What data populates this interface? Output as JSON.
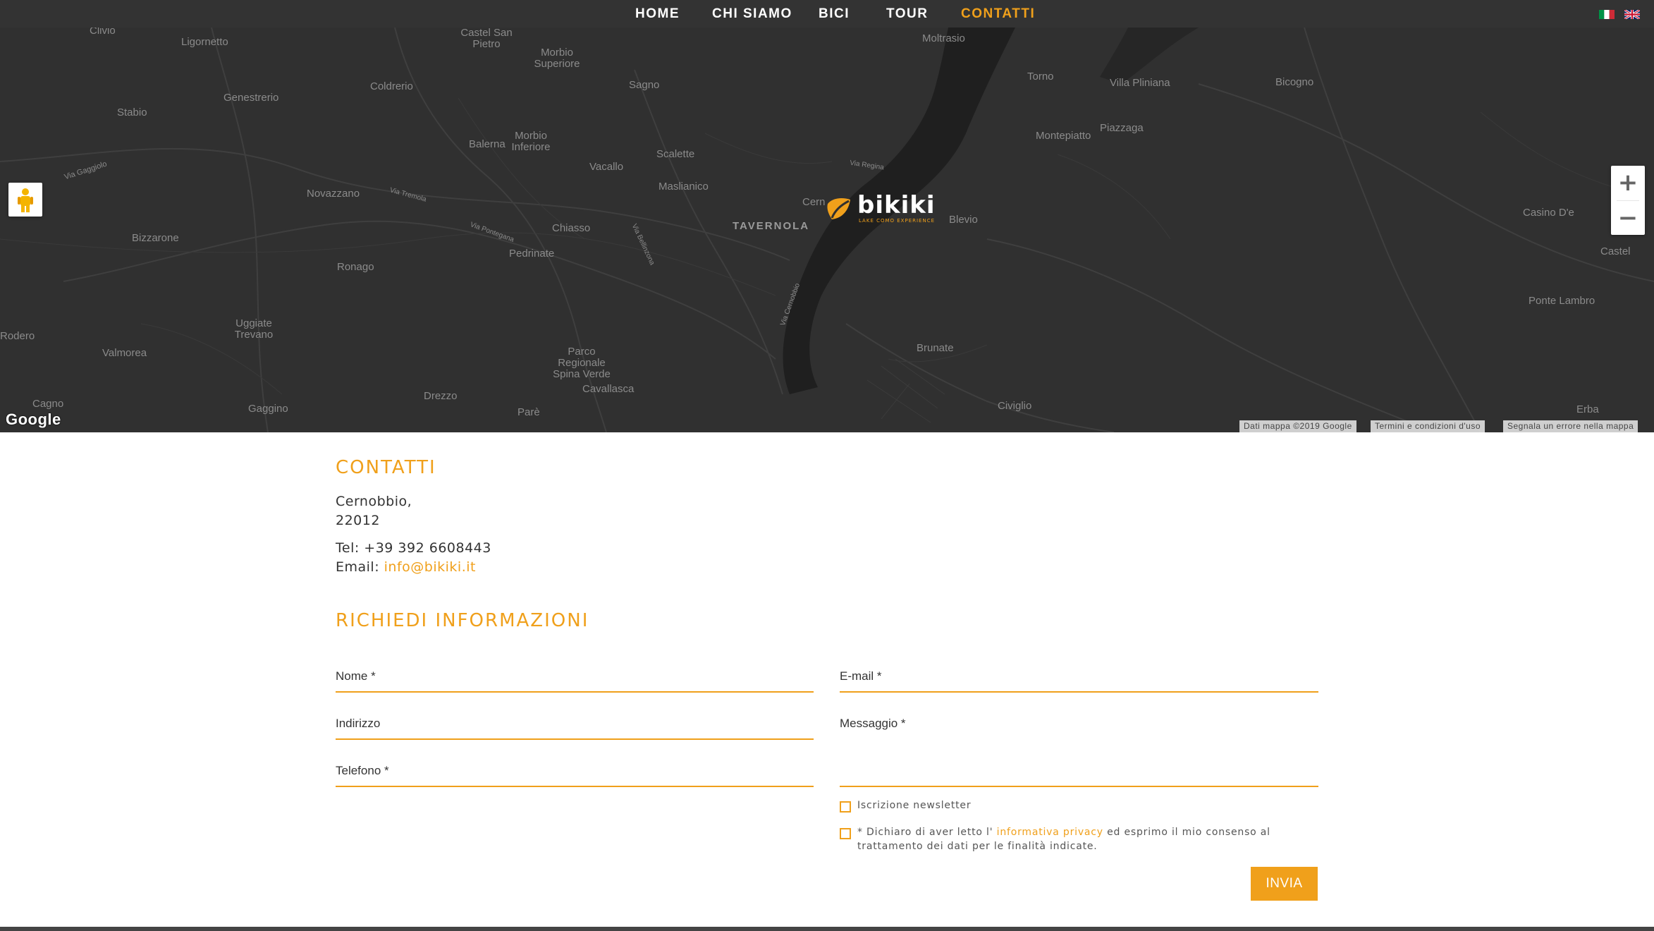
{
  "nav": {
    "items": [
      {
        "label": "HOME"
      },
      {
        "label": "CHI SIAMO"
      },
      {
        "label": "BICI"
      },
      {
        "label": "TOUR"
      },
      {
        "label": "CONTATTI",
        "active": true
      }
    ],
    "languages": [
      "italian-flag-icon",
      "uk-flag-icon"
    ]
  },
  "map": {
    "places": [
      "Clivio",
      "Ligornetto",
      "Castel San Pietro",
      "Morbio Superiore",
      "Moltrasio",
      "Torno",
      "Villa Pliniana",
      "Bicogno",
      "Stabio",
      "Genestrerio",
      "Coldrerio",
      "Sagno",
      "Montepiatto",
      "Piazzaga",
      "Balerna",
      "Morbio Inferiore",
      "Vacallo",
      "Scalette",
      "Novazzano",
      "Maslianico",
      "Cern",
      "Blevio",
      "Casino D'e",
      "Bizzarone",
      "Chiasso",
      "Pedrinate",
      "TAVERNOLA",
      "Castel",
      "Ronago",
      "Ponte Lambro",
      "Uggiate Trevano",
      "Rodero",
      "Valmorea",
      "Brunate",
      "Parco Regionale Spina Verde",
      "Cavallasca",
      "Drezzo",
      "Cagno",
      "Gaggino",
      "Parè",
      "Civiglio",
      "Erba"
    ],
    "roads": [
      "Via Gaggiolo",
      "Via Tremola",
      "Via Pontegana",
      "Via Cernobbio",
      "Via Regina",
      "Via Bellinzona"
    ],
    "brand_name": "bikiki",
    "brand_tagline": "LAKE COMO EXPERIENCE",
    "google_label": "Google",
    "attribution": [
      "Dati mappa ©2019 Google",
      "Termini e condizioni d'uso",
      "Segnala un errore nella mappa"
    ],
    "zoom_in": "+",
    "zoom_out": "−"
  },
  "contacts": {
    "title": "CONTATTI",
    "city": "Cernobbio,",
    "zip": "22012",
    "tel": "Tel: +39 392 6608443",
    "email_label": "Email: ",
    "email": "info@bikiki.it"
  },
  "form": {
    "title": "RICHIEDI INFORMAZIONI",
    "name_label": "Nome *",
    "email_label": "E-mail *",
    "address_label": "Indirizzo",
    "message_label": "Messaggio *",
    "phone_label": "Telefono *",
    "newsletter_label": "Iscrizione newsletter",
    "privacy_prefix": "* Dichiaro di aver letto l'",
    "privacy_link": " informativa privacy",
    "privacy_suffix": " ed esprimo il mio consenso al trattamento dei dati per le finalità indicate.",
    "submit_label": "INVIA"
  },
  "colors": {
    "accent": "#f0a01b",
    "nav_bg": "#333333",
    "map_bg": "#303030"
  }
}
